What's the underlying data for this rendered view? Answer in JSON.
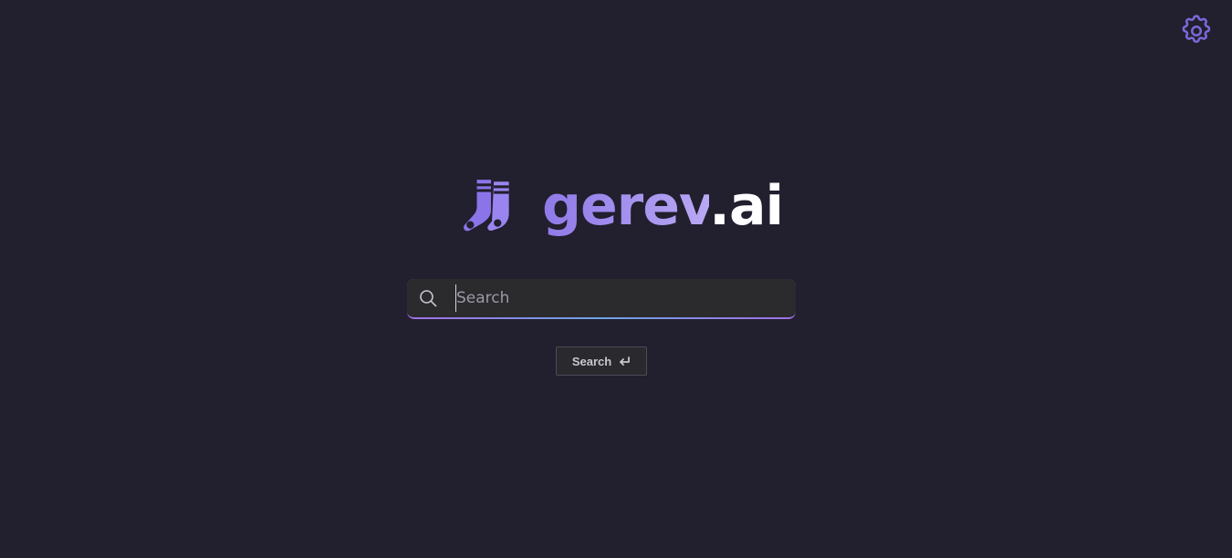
{
  "header": {
    "settings_icon": "gear-icon"
  },
  "logo": {
    "icon": "socks-icon",
    "brand_main": "gerev",
    "brand_tld": ".ai"
  },
  "search": {
    "placeholder": "Search",
    "value": "",
    "icon": "search-icon",
    "button_label": "Search",
    "button_icon": "enter-icon"
  },
  "colors": {
    "background": "#221f2e",
    "accent": "#8f79e8",
    "accent_light": "#b8a8f4",
    "input_background": "#2b2a2d"
  }
}
